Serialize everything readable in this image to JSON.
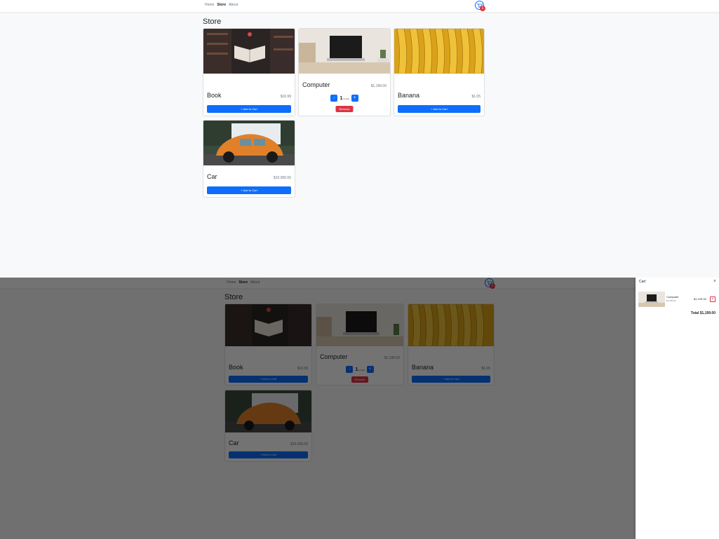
{
  "nav": {
    "home": "Home",
    "store": "Store",
    "about": "About"
  },
  "cart_count": "1",
  "page_title": "Store",
  "products": {
    "book": {
      "name": "Book",
      "price": "$10.99",
      "add_label": "+ Add to Cart"
    },
    "computer": {
      "name": "Computer",
      "price": "$1,199.00",
      "quantity": "1",
      "in_cart": "in cart",
      "minus": "-",
      "plus": "+",
      "remove_label": "Remove"
    },
    "banana": {
      "name": "Banana",
      "price": "$1.05",
      "add_label": "+ Add to Cart"
    },
    "car": {
      "name": "Car",
      "price": "$10,000.00",
      "add_label": "+ Add to Cart"
    }
  },
  "offcanvas": {
    "title": "Cart",
    "close": "×",
    "item": {
      "name": "Computer",
      "unit": "$1,199.00",
      "total": "$1,199.00",
      "remove": "×"
    },
    "total_label": "Total $1,199.00"
  },
  "colors": {
    "primary": "#0d6efd",
    "danger": "#dc3545",
    "overlay": "rgba(0,0,0,0.55)"
  }
}
